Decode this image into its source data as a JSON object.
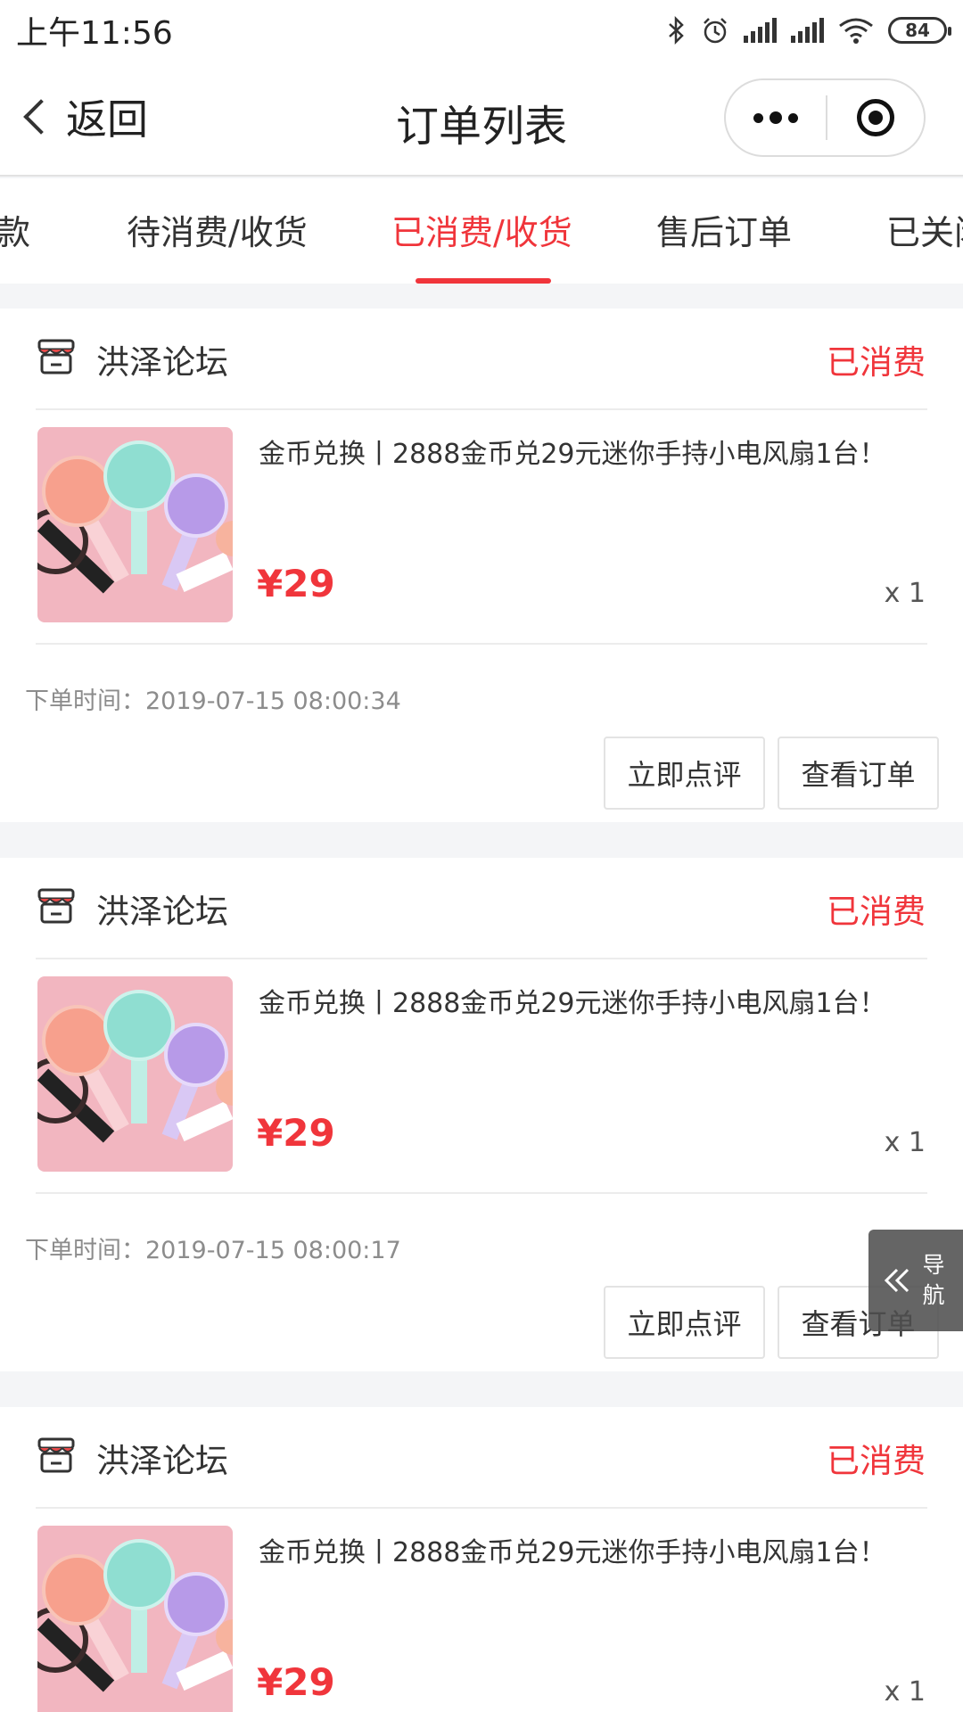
{
  "status_bar": {
    "time": "上午11:56",
    "battery": "84"
  },
  "nav": {
    "back_label": "返回",
    "title": "订单列表"
  },
  "tabs": [
    {
      "label": "款"
    },
    {
      "label": "待消费/收货"
    },
    {
      "label": "已消费/收货",
      "active": true
    },
    {
      "label": "售后订单"
    },
    {
      "label": "已关闭"
    }
  ],
  "orders": [
    {
      "shop_name": "洪泽论坛",
      "status": "已消费",
      "product_title": "金币兑换丨2888金币兑29元迷你手持小电风扇1台！",
      "price": "¥29",
      "quantity": "x 1",
      "order_time": "下单时间：2019-07-15 08:00:34",
      "review_label": "立即点评",
      "view_label": "查看订单"
    },
    {
      "shop_name": "洪泽论坛",
      "status": "已消费",
      "product_title": "金币兑换丨2888金币兑29元迷你手持小电风扇1台！",
      "price": "¥29",
      "quantity": "x 1",
      "order_time": "下单时间：2019-07-15 08:00:17",
      "review_label": "立即点评",
      "view_label": "查看订单"
    },
    {
      "shop_name": "洪泽论坛",
      "status": "已消费",
      "product_title": "金币兑换丨2888金币兑29元迷你手持小电风扇1台！",
      "price": "¥29",
      "quantity": "x 1"
    }
  ],
  "float_nav": {
    "label": "导航"
  },
  "icons": {
    "back": "chevron-left-icon",
    "more": "more-dots-icon",
    "close": "target-icon",
    "shop": "shop-icon",
    "float": "double-chevron-left-icon"
  },
  "colors": {
    "accent": "#f0353b",
    "background": "#f4f5f7"
  }
}
